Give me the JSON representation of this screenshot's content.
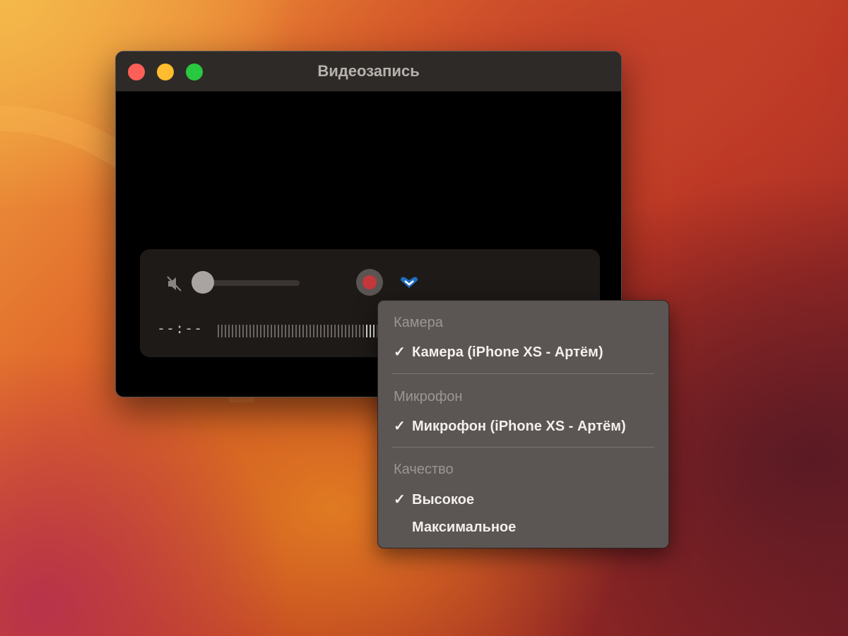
{
  "window": {
    "title": "Видеозапись"
  },
  "controls": {
    "time": "--:--",
    "volume": 0,
    "meter_level": 0.97
  },
  "menu": {
    "sections": [
      {
        "header": "Камера",
        "items": [
          {
            "label": "Камера (iPhone XS - Артём)",
            "checked": true
          }
        ]
      },
      {
        "header": "Микрофон",
        "items": [
          {
            "label": "Микрофон (iPhone XS - Артём)",
            "checked": true
          }
        ]
      },
      {
        "header": "Качество",
        "items": [
          {
            "label": "Высокое",
            "checked": true
          },
          {
            "label": "Максимальное",
            "checked": false
          }
        ]
      }
    ],
    "check_glyph": "✓"
  },
  "colors": {
    "close": "#fe5f57",
    "minimize": "#febc2e",
    "zoom": "#28c840",
    "record": "#c4373a",
    "accent": "#1f6fc0"
  }
}
